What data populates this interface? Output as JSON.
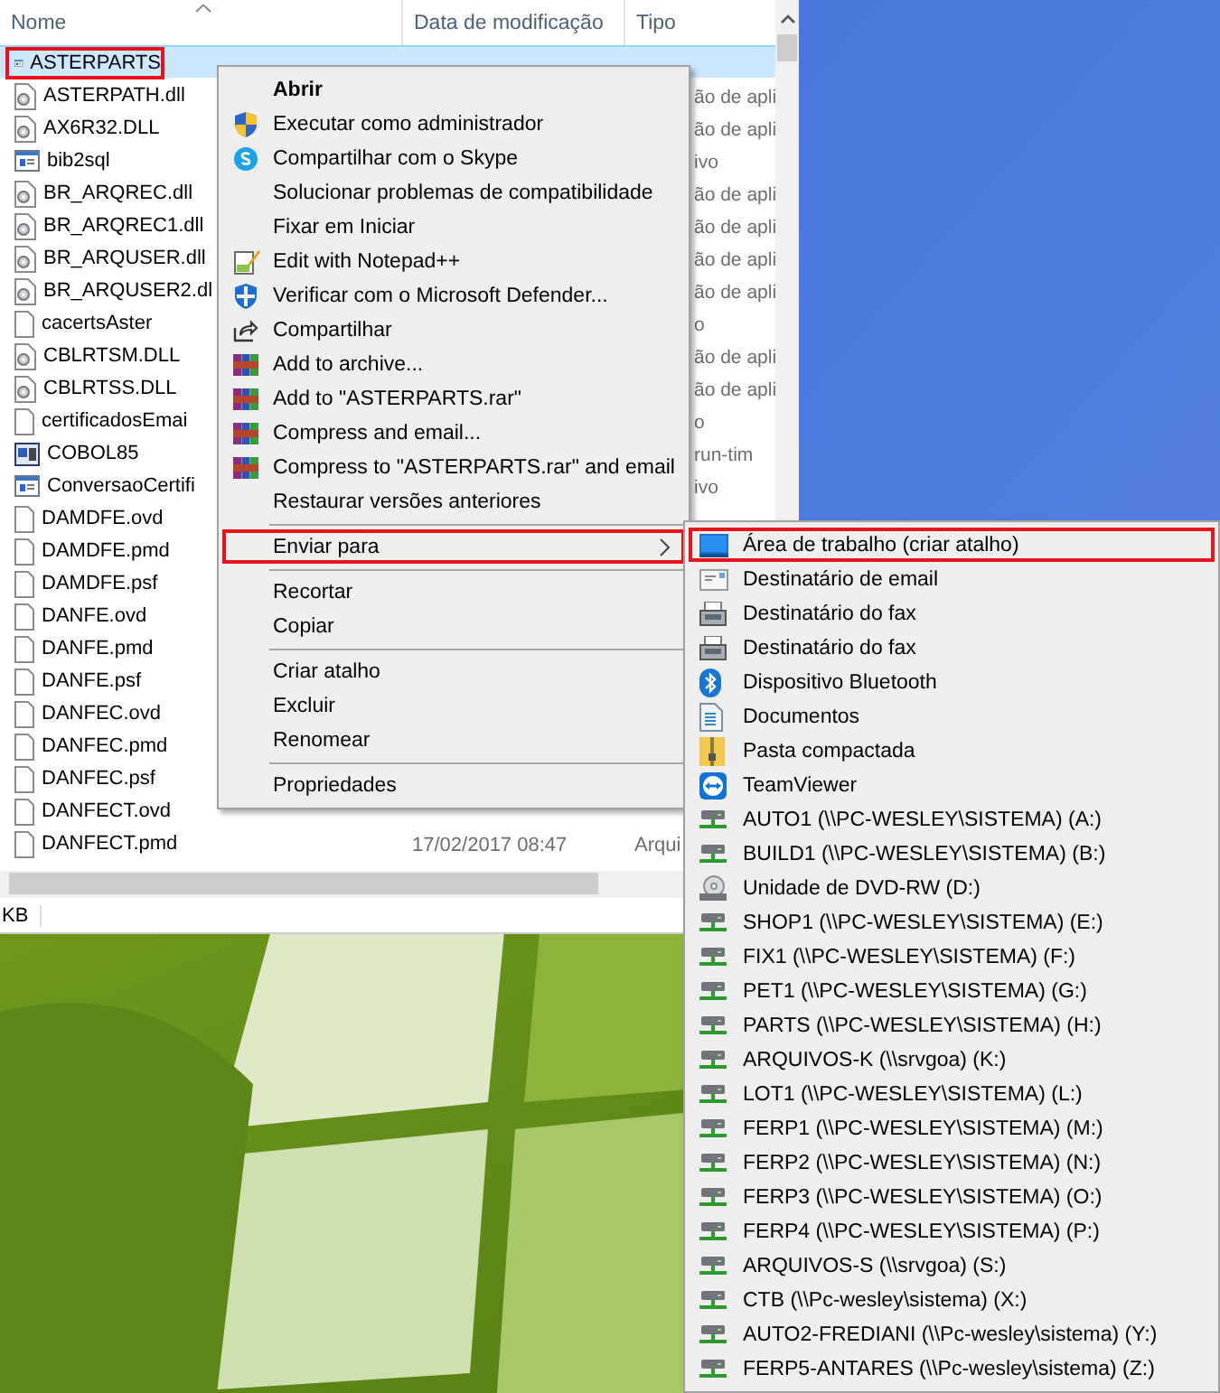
{
  "explorer": {
    "columns": [
      {
        "label": "Nome"
      },
      {
        "label": "Data de modificação"
      },
      {
        "label": "Tipo"
      }
    ],
    "files": [
      {
        "name": "ASTERPARTS",
        "kind": "app",
        "selected": true,
        "outlined": true
      },
      {
        "name": "ASTERPATH.dll",
        "kind": "dll",
        "type": "ão de apli",
        "selected": false,
        "outlined": false
      },
      {
        "name": "AX6R32.DLL",
        "kind": "dll",
        "type": "ão de apli",
        "selected": false,
        "outlined": false
      },
      {
        "name": "bib2sql",
        "kind": "app",
        "type": "ivo",
        "selected": false,
        "outlined": false
      },
      {
        "name": "BR_ARQREC.dll",
        "kind": "dll",
        "type": "ão de apli",
        "selected": false,
        "outlined": false
      },
      {
        "name": "BR_ARQREC1.dll",
        "kind": "dll",
        "type": "ão de apli",
        "selected": false,
        "outlined": false
      },
      {
        "name": "BR_ARQUSER.dll",
        "kind": "dll",
        "type": "ão de apli",
        "selected": false,
        "outlined": false
      },
      {
        "name": "BR_ARQUSER2.dl",
        "kind": "dll",
        "type": "ão de apli",
        "selected": false,
        "outlined": false
      },
      {
        "name": "cacertsAster",
        "kind": "file",
        "type": "o",
        "selected": false,
        "outlined": false
      },
      {
        "name": "CBLRTSM.DLL",
        "kind": "dll",
        "type": "ão de apli",
        "selected": false,
        "outlined": false
      },
      {
        "name": "CBLRTSS.DLL",
        "kind": "dll",
        "type": "ão de apli",
        "selected": false,
        "outlined": false
      },
      {
        "name": "certificadosEmai",
        "kind": "file",
        "type": "o",
        "selected": false,
        "outlined": false
      },
      {
        "name": "COBOL85",
        "kind": "exe",
        "type": "run-tim",
        "selected": false,
        "outlined": false
      },
      {
        "name": "ConversaoCertifi",
        "kind": "app",
        "type": "ivo",
        "selected": false,
        "outlined": false
      },
      {
        "name": "DAMDFE.ovd",
        "kind": "file",
        "selected": false,
        "outlined": false
      },
      {
        "name": "DAMDFE.pmd",
        "kind": "file",
        "selected": false,
        "outlined": false
      },
      {
        "name": "DAMDFE.psf",
        "kind": "file",
        "selected": false,
        "outlined": false
      },
      {
        "name": "DANFE.ovd",
        "kind": "file",
        "selected": false,
        "outlined": false
      },
      {
        "name": "DANFE.pmd",
        "kind": "file",
        "selected": false,
        "outlined": false
      },
      {
        "name": "DANFE.psf",
        "kind": "file",
        "selected": false,
        "outlined": false
      },
      {
        "name": "DANFEC.ovd",
        "kind": "file",
        "selected": false,
        "outlined": false
      },
      {
        "name": "DANFEC.pmd",
        "kind": "file",
        "selected": false,
        "outlined": false
      },
      {
        "name": "DANFEC.psf",
        "kind": "file",
        "selected": false,
        "outlined": false
      },
      {
        "name": "DANFECT.ovd",
        "kind": "file",
        "selected": false,
        "outlined": false
      },
      {
        "name": "DANFECT.pmd",
        "kind": "file",
        "date": "17/02/2017 08:47",
        "type": "Arqui",
        "selected": false,
        "outlined": false
      }
    ],
    "status_bar": "KB"
  },
  "context_menu": {
    "items": [
      {
        "kind": "plain",
        "label": "Abrir",
        "default": true,
        "outlined": false
      },
      {
        "kind": "shield",
        "label": "Executar como administrador",
        "default": false,
        "outlined": false
      },
      {
        "kind": "skype",
        "label": "Compartilhar com o Skype",
        "default": false,
        "outlined": false
      },
      {
        "kind": "plain",
        "label": "Solucionar problemas de compatibilidade",
        "default": false,
        "outlined": false
      },
      {
        "kind": "plain",
        "label": "Fixar em Iniciar",
        "default": false,
        "outlined": false
      },
      {
        "kind": "notepad",
        "label": "Edit with Notepad++",
        "default": false,
        "outlined": false
      },
      {
        "kind": "defender",
        "label": "Verificar com o Microsoft Defender...",
        "default": false,
        "outlined": false
      },
      {
        "kind": "share",
        "label": "Compartilhar",
        "default": false,
        "outlined": false
      },
      {
        "kind": "rar",
        "label": "Add to archive...",
        "default": false,
        "outlined": false
      },
      {
        "kind": "rar",
        "label": "Add to \"ASTERPARTS.rar\"",
        "default": false,
        "outlined": false
      },
      {
        "kind": "rar",
        "label": "Compress and email...",
        "default": false,
        "outlined": false
      },
      {
        "kind": "rar",
        "label": "Compress to \"ASTERPARTS.rar\" and email",
        "default": false,
        "outlined": false
      },
      {
        "kind": "plain",
        "label": "Restaurar versões anteriores",
        "default": false,
        "outlined": false
      },
      {
        "kind": "separator"
      },
      {
        "kind": "submenu",
        "label": "Enviar para",
        "default": false,
        "outlined": true
      },
      {
        "kind": "separator"
      },
      {
        "kind": "plain",
        "label": "Recortar",
        "default": false,
        "outlined": false
      },
      {
        "kind": "plain",
        "label": "Copiar",
        "default": false,
        "outlined": false
      },
      {
        "kind": "separator"
      },
      {
        "kind": "plain",
        "label": "Criar atalho",
        "default": false,
        "outlined": false
      },
      {
        "kind": "plain",
        "label": "Excluir",
        "default": false,
        "outlined": false
      },
      {
        "kind": "plain",
        "label": "Renomear",
        "default": false,
        "outlined": false
      },
      {
        "kind": "separator"
      },
      {
        "kind": "plain",
        "label": "Propriedades",
        "default": false,
        "outlined": false
      }
    ]
  },
  "send_to_menu": {
    "items": [
      {
        "label": "Área de trabalho (criar atalho)",
        "kind": "desktop",
        "outlined": true
      },
      {
        "label": "Destinatário de email",
        "kind": "mail",
        "outlined": false
      },
      {
        "label": "Destinatário do fax",
        "kind": "fax",
        "outlined": false
      },
      {
        "label": "Destinatário do fax",
        "kind": "fax",
        "outlined": false
      },
      {
        "label": "Dispositivo Bluetooth",
        "kind": "bluetooth",
        "outlined": false
      },
      {
        "label": "Documentos",
        "kind": "documents",
        "outlined": false
      },
      {
        "label": "Pasta compactada",
        "kind": "zip",
        "outlined": false
      },
      {
        "label": "TeamViewer",
        "kind": "teamviewer",
        "outlined": false
      },
      {
        "label": "AUTO1 (\\\\PC-WESLEY\\SISTEMA) (A:)",
        "kind": "network",
        "outlined": false
      },
      {
        "label": "BUILD1 (\\\\PC-WESLEY\\SISTEMA) (B:)",
        "kind": "network",
        "outlined": false
      },
      {
        "label": "Unidade de DVD-RW (D:)",
        "kind": "dvd",
        "outlined": false
      },
      {
        "label": "SHOP1 (\\\\PC-WESLEY\\SISTEMA) (E:)",
        "kind": "network",
        "outlined": false
      },
      {
        "label": "FIX1 (\\\\PC-WESLEY\\SISTEMA) (F:)",
        "kind": "network",
        "outlined": false
      },
      {
        "label": "PET1 (\\\\PC-WESLEY\\SISTEMA) (G:)",
        "kind": "network",
        "outlined": false
      },
      {
        "label": "PARTS (\\\\PC-WESLEY\\SISTEMA) (H:)",
        "kind": "network",
        "outlined": false
      },
      {
        "label": "ARQUIVOS-K (\\\\srvgoa) (K:)",
        "kind": "network",
        "outlined": false
      },
      {
        "label": "LOT1 (\\\\PC-WESLEY\\SISTEMA) (L:)",
        "kind": "network",
        "outlined": false
      },
      {
        "label": "FERP1 (\\\\PC-WESLEY\\SISTEMA) (M:)",
        "kind": "network",
        "outlined": false
      },
      {
        "label": "FERP2 (\\\\PC-WESLEY\\SISTEMA) (N:)",
        "kind": "network",
        "outlined": false
      },
      {
        "label": "FERP3 (\\\\PC-WESLEY\\SISTEMA) (O:)",
        "kind": "network",
        "outlined": false
      },
      {
        "label": "FERP4 (\\\\PC-WESLEY\\SISTEMA) (P:)",
        "kind": "network",
        "outlined": false
      },
      {
        "label": "ARQUIVOS-S (\\\\srvgoa) (S:)",
        "kind": "network",
        "outlined": false
      },
      {
        "label": "CTB (\\\\Pc-wesley\\sistema) (X:)",
        "kind": "network",
        "outlined": false
      },
      {
        "label": "AUTO2-FREDIANI (\\\\Pc-wesley\\sistema) (Y:)",
        "kind": "network",
        "outlined": false
      },
      {
        "label": "FERP5-ANTARES (\\\\Pc-wesley\\sistema) (Z:)",
        "kind": "network",
        "outlined": false
      }
    ]
  }
}
